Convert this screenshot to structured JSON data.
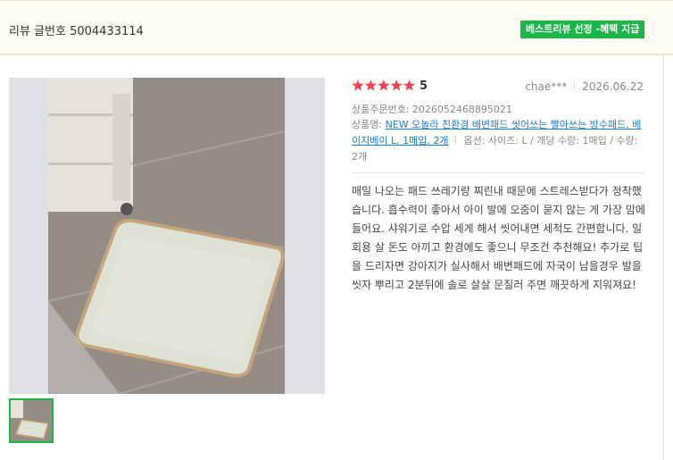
{
  "header": {
    "review_id": "리뷰 글번호 5004433114",
    "badge": "베스트리뷰 선정 -혜택 지급"
  },
  "review": {
    "rating": 5,
    "rating_label": "5",
    "author": "chae***",
    "date": "2026.06.22",
    "order_no": "상품주문번호: 2026052468895021",
    "product_prefix": "상품명:",
    "product_name": "NEW 오놀라 친환경 배변패드 씻어쓰는 빨아쓰는 방수패드, 베이지베이 L, 1매입, 2개",
    "options": "옵션: 사이즈: L / 개당 수량: 1매입 / 수량: 2개",
    "text": "매일 나오는 패드 쓰레기랑 찌린내 때문에 스트레스받다가 정착했습니다. 흡수력이 좋아서 아이 발에 오줌이 묻지 않는 게 가장 맘에 들어요. 샤워기로 수압 세게 해서 씻어내면 세척도 간편합니다. 일회용 살 돈도 아끼고 환경에도 좋으니 무조건 추천해요! 추가로 팁을 드리자면 강아지가 실사해서 배변패드에 자국이 남을경우 발을씻자 뿌리고 2분뒤에 솔로 살살 문질러 주면 깨끗하게 지워져요!"
  },
  "photo": {
    "thumb_count": 1
  },
  "colors": {
    "star": "#f0424f",
    "accent_green": "#1bb548",
    "link": "#1a7bd6"
  }
}
